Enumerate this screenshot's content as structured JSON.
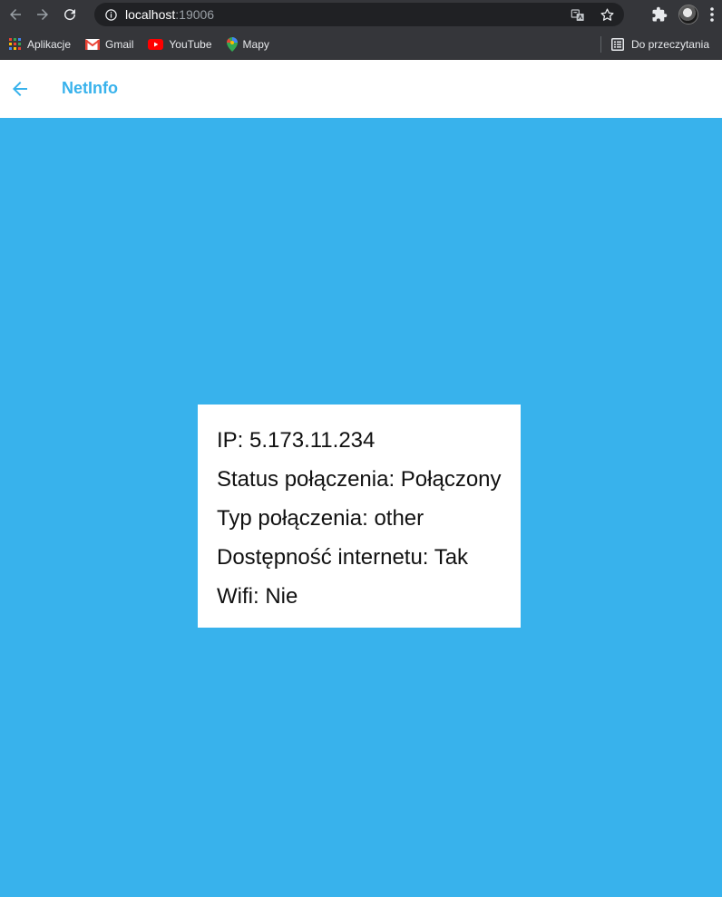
{
  "browser": {
    "url_host": "localhost",
    "url_port": ":19006",
    "bookmarks": [
      {
        "label": "Aplikacje",
        "icon": "apps-grid-icon"
      },
      {
        "label": "Gmail",
        "icon": "gmail-icon"
      },
      {
        "label": "YouTube",
        "icon": "youtube-icon"
      },
      {
        "label": "Mapy",
        "icon": "maps-icon"
      }
    ],
    "reading_list": "Do przeczytania"
  },
  "appbar": {
    "title": "NetInfo",
    "accent": "#38b2ec"
  },
  "netinfo": {
    "ip": "IP: 5.173.11.234",
    "status": "Status połączenia: Połączony",
    "type": "Typ połączenia: other",
    "internet": "Dostępność internetu: Tak",
    "wifi": "Wifi: Nie"
  },
  "colors": {
    "background": "#38b2ec",
    "card": "#ffffff",
    "chrome": "#35363a"
  }
}
